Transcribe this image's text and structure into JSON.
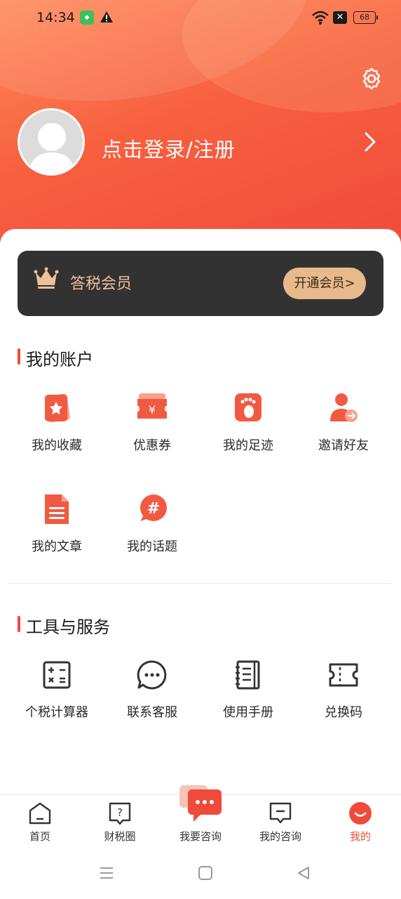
{
  "status_bar": {
    "time": "14:34",
    "battery": "68"
  },
  "profile": {
    "login_text": "点击登录/注册"
  },
  "vip": {
    "label": "答税会员",
    "button": "开通会员>"
  },
  "account": {
    "title": "我的账户",
    "items": [
      {
        "label": "我的收藏",
        "icon": "star-card-icon"
      },
      {
        "label": "优惠券",
        "icon": "coupon-icon"
      },
      {
        "label": "我的足迹",
        "icon": "footprint-icon"
      },
      {
        "label": "邀请好友",
        "icon": "invite-friend-icon"
      },
      {
        "label": "我的文章",
        "icon": "article-icon"
      },
      {
        "label": "我的话题",
        "icon": "topic-hash-icon"
      }
    ]
  },
  "tools": {
    "title": "工具与服务",
    "items": [
      {
        "label": "个税计算器",
        "icon": "calculator-icon"
      },
      {
        "label": "联系客服",
        "icon": "chat-bubble-icon"
      },
      {
        "label": "使用手册",
        "icon": "manual-icon"
      },
      {
        "label": "兑换码",
        "icon": "ticket-icon"
      }
    ]
  },
  "tabbar": {
    "items": [
      {
        "label": "首页",
        "icon": "home-icon"
      },
      {
        "label": "财税圈",
        "icon": "question-circle-icon"
      },
      {
        "label": "我要咨询",
        "icon": "consult-bubble-icon"
      },
      {
        "label": "我的咨询",
        "icon": "message-icon"
      },
      {
        "label": "我的",
        "icon": "profile-face-icon",
        "active": true
      }
    ]
  },
  "colors": {
    "accent": "#f04b3a",
    "vip_gold": "#ecc19a",
    "vip_bg": "#333232"
  }
}
